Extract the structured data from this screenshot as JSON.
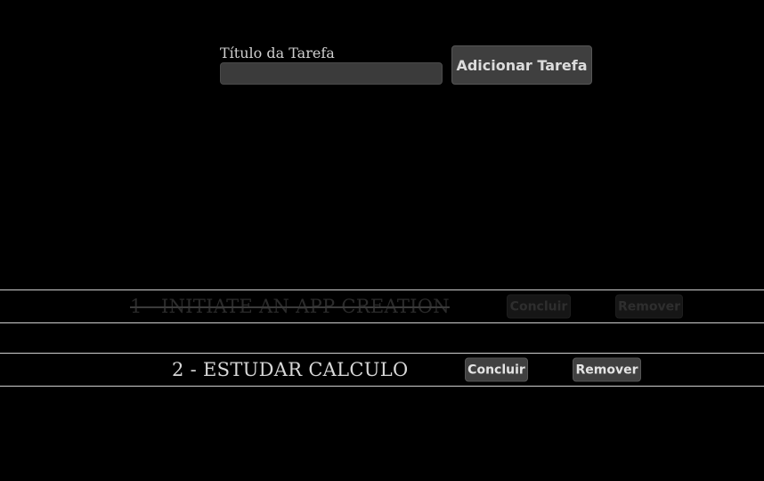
{
  "form": {
    "label": "Título da Tarefa",
    "input_value": "",
    "input_placeholder": "",
    "add_button_label": "Adicionar Tarefa"
  },
  "tasks": [
    {
      "title": "1 - INITIATE AN APP CREATION",
      "completed": true,
      "complete_label": "Concluir",
      "remove_label": "Remover"
    },
    {
      "title": "2 - ESTUDAR CALCULO",
      "completed": false,
      "complete_label": "Concluir",
      "remove_label": "Remover"
    }
  ],
  "colors": {
    "background": "#000000",
    "text": "#d8d8d8",
    "button": "#404040",
    "completed_text": "#2b2b2b"
  }
}
